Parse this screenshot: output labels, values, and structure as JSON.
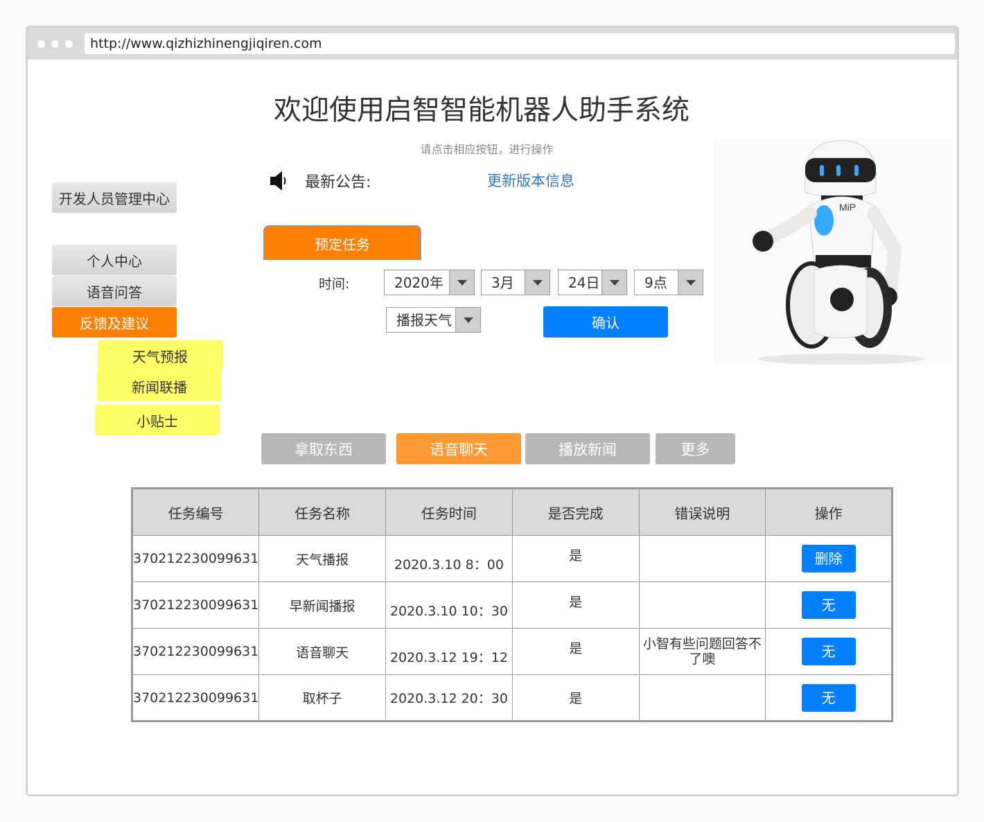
{
  "browser": {
    "url": "http://www.qizhizhinengjiqiren.com"
  },
  "header": {
    "title": "欢迎使用启智智能机器人助手系统",
    "subtitle": "请点击相应按钮，进行操作"
  },
  "notice": {
    "label": "最新公告:",
    "link": "更新版本信息",
    "icon": "speaker-icon"
  },
  "sidebar": {
    "dev_center": "开发人员管理中心",
    "items": [
      {
        "label": "个人中心",
        "style": "gray"
      },
      {
        "label": "语音问答",
        "style": "gray"
      },
      {
        "label": "反馈及建议",
        "style": "orange"
      }
    ],
    "subitems": [
      {
        "label": "天气预报"
      },
      {
        "label": "新闻联播"
      },
      {
        "label": "小贴士"
      }
    ]
  },
  "schedule": {
    "tab": "预定任务",
    "time_label": "时间:",
    "year": "2020年",
    "month": "3月",
    "day": "24日",
    "hour": "9点",
    "task_type": "播报天气",
    "confirm": "确认"
  },
  "functions": [
    {
      "label": "拿取东西",
      "active": false
    },
    {
      "label": "语音聊天",
      "active": true
    },
    {
      "label": "播放新闻",
      "active": false
    },
    {
      "label": "更多",
      "active": false
    }
  ],
  "table": {
    "headers": [
      "任务编号",
      "任务名称",
      "任务时间",
      "是否完成",
      "错误说明",
      "操作"
    ],
    "rows": [
      {
        "id": "370212230099631",
        "name": "天气播报",
        "time": "2020.3.10 8：00",
        "done": "是",
        "error": "",
        "action": "删除"
      },
      {
        "id": "370212230099631",
        "name": "早新闻播报",
        "time": "2020.3.10 10：30",
        "done": "是",
        "error": "",
        "action": "无"
      },
      {
        "id": "370212230099631",
        "name": "语音聊天",
        "time": "2020.3.12 19：12",
        "done": "是",
        "error": "小智有些问题回答不了噢",
        "action": "无"
      },
      {
        "id": "370212230099631",
        "name": "取杯子",
        "time": "2020.3.12 20：30",
        "done": "是",
        "error": "",
        "action": "无"
      }
    ]
  },
  "colors": {
    "orange": "#ff8000",
    "blue": "#0080ff",
    "link": "#337ab7",
    "yellow": "#ffff66"
  }
}
